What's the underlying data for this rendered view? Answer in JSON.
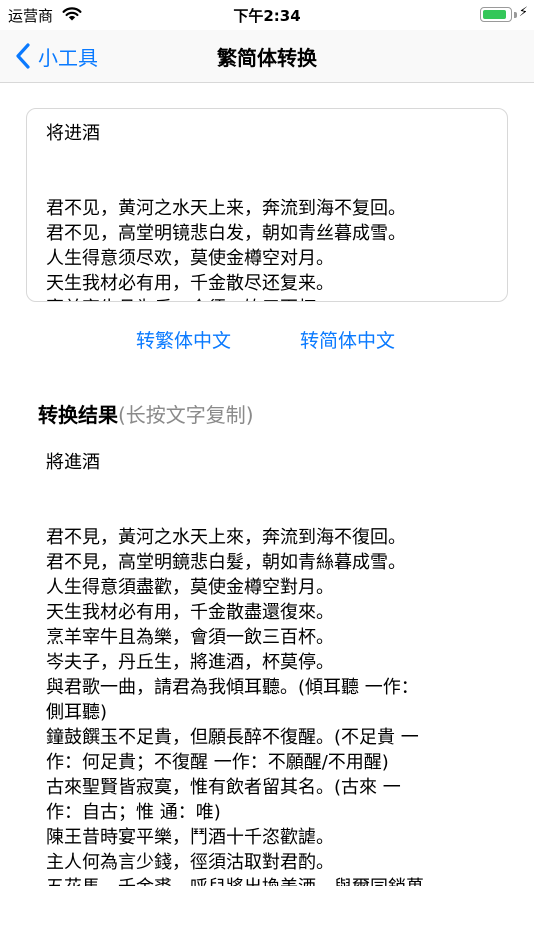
{
  "status_bar": {
    "carrier": "运营商",
    "time": "下午2:34",
    "battery_level": 0.9
  },
  "nav": {
    "back_label": "小工具",
    "title": "繁简体转换"
  },
  "input": {
    "text": "将进酒\n\n\n君不见，黄河之水天上来，奔流到海不复回。\n君不见，高堂明镜悲白发，朝如青丝暮成雪。\n人生得意须尽欢，莫使金樽空对月。\n天生我材必有用，千金散尽还复来。\n烹羊宰牛且为乐，会须一饮三百杯。"
  },
  "buttons": {
    "to_traditional": "转繁体中文",
    "to_simplified": "转简体中文"
  },
  "result": {
    "title": "转换结果",
    "hint": "(长按文字复制)",
    "text": "將進酒\n\n\n君不見，黃河之水天上來，奔流到海不復回。\n君不見，高堂明鏡悲白髮，朝如青絲暮成雪。\n人生得意須盡歡，莫使金樽空對月。\n天生我材必有用，千金散盡還復來。\n烹羊宰牛且為樂，會須一飲三百杯。\n岑夫子，丹丘生，將進酒，杯莫停。\n與君歌一曲，請君為我傾耳聽。(傾耳聽 一作：\n側耳聽)\n鐘鼓饌玉不足貴，但願長醉不復醒。(不足貴 一\n作：何足貴；不復醒 一作：不願醒/不用醒)\n古來聖賢皆寂寞，惟有飲者留其名。(古來 一\n作：自古；惟 通：唯)\n陳王昔時宴平樂，鬥酒十千恣歡謔。\n主人何為言少錢，徑須沽取對君酌。\n五花馬，千金裘，呼兒將出換美酒，與爾同銷萬"
  }
}
